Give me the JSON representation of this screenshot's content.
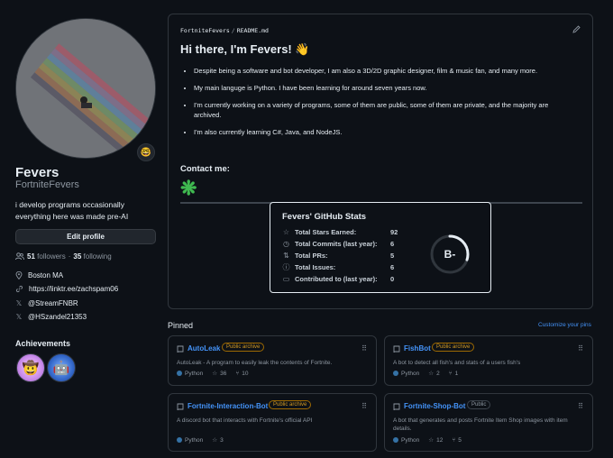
{
  "profile": {
    "name": "Fevers",
    "login": "FortniteFevers",
    "bio_lines": [
      "i develop programs occasionally",
      "everything here was made pre-AI"
    ],
    "status_emoji": "🤓",
    "edit_label": "Edit profile",
    "followers_count": "51",
    "followers_label": "followers",
    "separator": "·",
    "following_count": "35",
    "following_label": "following",
    "location": "Boston MA",
    "website": "https://linktr.ee/zachspam06",
    "socials": [
      "@StreamFNBR",
      "@HSzandel21353"
    ]
  },
  "achievements": {
    "title": "Achievements",
    "badges": [
      {
        "name": "pull-shark",
        "emoji": "🤠",
        "color": "#e9a8ff"
      },
      {
        "name": "quickdraw",
        "emoji": "🤖",
        "color": "#3468c9"
      }
    ]
  },
  "readme": {
    "breadcrumb_owner": "FortniteFevers",
    "breadcrumb_sep": "/",
    "breadcrumb_file": "README.md",
    "heading": "Hi there, I'm Fevers! 👋",
    "bullets": [
      "Despite being a software and bot developer, I am also a 3D/2D graphic designer, film & music fan, and many more.",
      "My main languge is Python. I have been learning for around seven years now.",
      "I'm currently working on a variety of programs, some of them are public, some of them are private, and the majority are archived.",
      "I'm also currently learning C#, Java, and NodeJS."
    ],
    "contact_heading": "Contact me:",
    "contact_glyph": "❋"
  },
  "stats_card": {
    "title": "Fevers' GitHub Stats",
    "rows": [
      {
        "icon": "star-icon",
        "glyph": "☆",
        "label": "Total Stars Earned:",
        "value": "92"
      },
      {
        "icon": "clock-icon",
        "glyph": "◷",
        "label": "Total Commits (last year):",
        "value": "6"
      },
      {
        "icon": "pull-request-icon",
        "glyph": "⇅",
        "label": "Total PRs:",
        "value": "5"
      },
      {
        "icon": "issue-icon",
        "glyph": "ⓘ",
        "label": "Total Issues:",
        "value": "6"
      },
      {
        "icon": "repo-icon",
        "glyph": "▭",
        "label": "Contributed to (last year):",
        "value": "0"
      }
    ],
    "grade": "B-",
    "grade_progress": 0.3,
    "ring_color": "#e6edf3",
    "track_color": "#30363d"
  },
  "pinned": {
    "title": "Pinned",
    "customize_label": "Customize your pins",
    "repos": [
      {
        "name": "AutoLeak",
        "visibility": "Public archive",
        "archived": true,
        "description": "AutoLeak - A program to easily leak the contents of Fortnite.",
        "language": "Python",
        "lang_color": "#3572A5",
        "stars": "36",
        "forks": "10"
      },
      {
        "name": "FishBot",
        "visibility": "Public archive",
        "archived": true,
        "description": "A bot to detect all fish's and stats of a users fish's",
        "language": "Python",
        "lang_color": "#3572A5",
        "stars": "2",
        "forks": "1"
      },
      {
        "name": "Fortnite-Interaction-Bot",
        "visibility": "Public archive",
        "archived": true,
        "description": "A discord bot that interacts with Fortnite's official API",
        "language": "Python",
        "lang_color": "#3572A5",
        "stars": "3",
        "forks": ""
      },
      {
        "name": "Fortnite-Shop-Bot",
        "visibility": "Public",
        "archived": false,
        "description": "A bot that generates and posts Fortnite Item Shop images with item details.",
        "language": "Python",
        "lang_color": "#3572A5",
        "stars": "12",
        "forks": "5"
      }
    ]
  },
  "colors": {
    "bg": "#0d1117",
    "border": "#30363d",
    "link": "#4493f8",
    "muted": "#8d96a0",
    "archive": "#d29922"
  }
}
